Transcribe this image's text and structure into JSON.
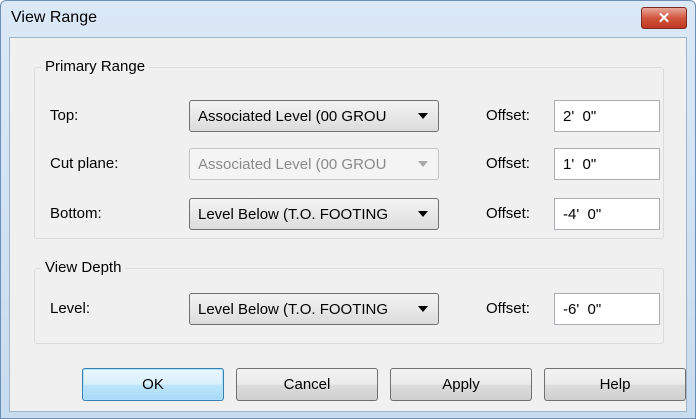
{
  "window": {
    "title": "View Range"
  },
  "primary_range": {
    "label": "Primary Range",
    "rows": [
      {
        "label": "Top:",
        "combo_value": "Associated Level (00 GROU",
        "offset_label": "Offset:",
        "offset_value": "2'  0\""
      },
      {
        "label": "Cut plane:",
        "combo_value": "Associated Level (00 GROU",
        "offset_label": "Offset:",
        "offset_value": "1'  0\""
      },
      {
        "label": "Bottom:",
        "combo_value": "Level Below (T.O. FOOTING",
        "offset_label": "Offset:",
        "offset_value": "-4'  0\""
      }
    ]
  },
  "view_depth": {
    "label": "View Depth",
    "row": {
      "label": "Level:",
      "combo_value": "Level Below (T.O. FOOTING",
      "offset_label": "Offset:",
      "offset_value": "-6'  0\""
    }
  },
  "buttons": {
    "ok": "OK",
    "cancel": "Cancel",
    "apply": "Apply",
    "help": "Help"
  },
  "icons": {
    "close": "close-icon",
    "dropdown": "chevron-down-icon"
  }
}
